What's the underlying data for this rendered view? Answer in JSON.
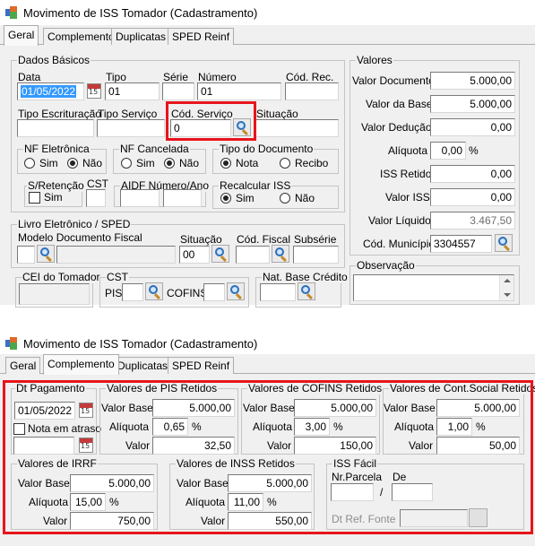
{
  "window_title": "Movimento de ISS Tomador (Cadastramento)",
  "tabs": [
    "Geral",
    "Complemento",
    "Duplicatas",
    "SPED Reinf"
  ],
  "calendar_icon_text": "15",
  "geral": {
    "dados_basicos": {
      "title": "Dados Básicos",
      "data_label": "Data",
      "data_value": "01/05/2022",
      "tipo_label": "Tipo",
      "tipo_value": "01",
      "serie_label": "Série",
      "serie_value": "",
      "numero_label": "Número",
      "numero_value": "01",
      "cod_rec_label": "Cód. Rec.",
      "cod_rec_value": "",
      "tipo_escrituracao_label": "Tipo Escrituração",
      "tipo_servico_label": "Tipo Serviço",
      "cod_servico_label": "Cód. Serviço",
      "cod_servico_value": "0",
      "situacao_label": "Situação",
      "nf_eletronica_title": "NF Eletrônica",
      "nf_eletronica_sim": "Sim",
      "nf_eletronica_nao": "Não",
      "nf_cancelada_title": "NF Cancelada",
      "nf_cancelada_sim": "Sim",
      "nf_cancelada_nao": "Não",
      "tipo_documento_title": "Tipo do Documento",
      "tipo_documento_nota": "Nota",
      "tipo_documento_recibo": "Recibo",
      "s_retencao_title": "S/Retenção",
      "s_retencao_sim": "Sim",
      "cst_label": "CST",
      "aidf_title": "AIDF Número/Ano",
      "recalcular_iss_title": "Recalcular ISS",
      "recalcular_sim": "Sim",
      "recalcular_nao": "Não"
    },
    "livro": {
      "title": "Livro Eletrônico / SPED",
      "modelo_label": "Modelo Documento Fiscal",
      "situacao_label": "Situação",
      "situacao_value": "00",
      "cod_fiscal_label": "Cód. Fiscal",
      "subserie_label": "Subsérie"
    },
    "cei_label": "CEI do Tomador",
    "cst_group": {
      "title": "CST",
      "pis_label": "PIS",
      "cofins_label": "COFINS"
    },
    "nat_base_label": "Nat. Base Crédito",
    "valores": {
      "title": "Valores",
      "valor_documento_label": "Valor Documento",
      "valor_documento": "5.000,00",
      "valor_base_label": "Valor da Base",
      "valor_base": "5.000,00",
      "valor_deducao_label": "Valor Dedução",
      "valor_deducao": "0,00",
      "aliquota_label": "Alíquota",
      "aliquota": "0,00",
      "pct": "%",
      "iss_retido_label": "ISS Retido",
      "iss_retido": "0,00",
      "valor_iss_label": "Valor ISS",
      "valor_iss": "0,00",
      "valor_liquido_label": "Valor Líquido",
      "valor_liquido": "3.467,50",
      "cod_municipio_label": "Cód. Município",
      "cod_municipio": "3304557"
    },
    "observacao_label": "Observação"
  },
  "complemento": {
    "dt_pagamento_title": "Dt Pagamento",
    "dt_pagamento_value": "01/05/2022",
    "nota_em_atraso_label": "Nota em atraso",
    "pis": {
      "title": "Valores de PIS Retidos",
      "base_label": "Valor Base",
      "base": "5.000,00",
      "aliquota_label": "Alíquota",
      "aliquota": "0,65",
      "valor_label": "Valor",
      "valor": "32,50"
    },
    "cofins": {
      "title": "Valores de COFINS Retidos",
      "base_label": "Valor Base",
      "base": "5.000,00",
      "aliquota_label": "Alíquota",
      "aliquota": "3,00",
      "valor_label": "Valor",
      "valor": "150,00"
    },
    "csocial": {
      "title": "Valores de Cont.Social Retidos",
      "base_label": "Valor Base",
      "base": "5.000,00",
      "aliquota_label": "Alíquota",
      "aliquota": "1,00",
      "valor_label": "Valor",
      "valor": "50,00"
    },
    "irrf": {
      "title": "Valores de IRRF",
      "base_label": "Valor Base",
      "base": "5.000,00",
      "aliquota_label": "Alíquota",
      "aliquota": "15,00",
      "valor_label": "Valor",
      "valor": "750,00"
    },
    "inss": {
      "title": "Valores de INSS Retidos",
      "base_label": "Valor Base",
      "base": "5.000,00",
      "aliquota_label": "Alíquota",
      "aliquota": "11,00",
      "valor_label": "Valor",
      "valor": "550,00"
    },
    "pct": "%",
    "iss_facil": {
      "title": "ISS Fácil",
      "nr_parcela_label": "Nr.Parcela",
      "de_label": "De",
      "slash": "/",
      "dt_ref_fonte_label": "Dt Ref. Fonte"
    }
  },
  "colors": {
    "highlight": "#e8141c",
    "selection": "#3399ff"
  }
}
